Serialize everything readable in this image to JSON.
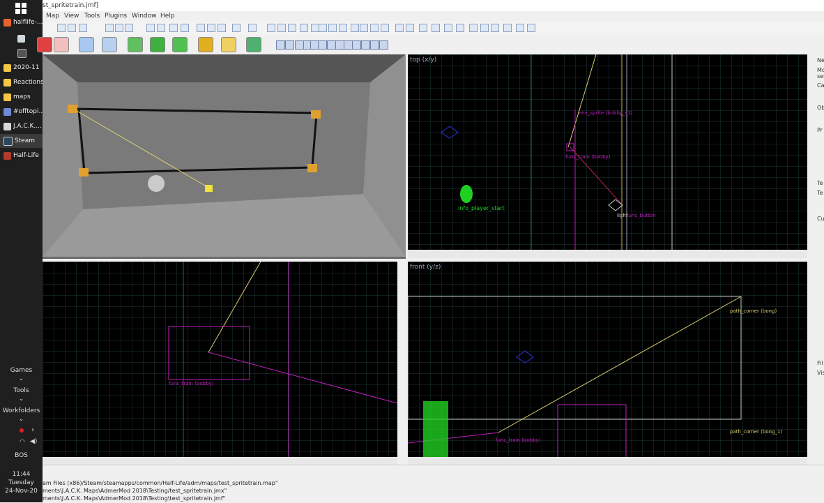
{
  "taskbar": {
    "items": [
      {
        "label": "halflife-...",
        "color": "#e9622e"
      },
      {
        "label": "",
        "color": "#cfd8dc"
      },
      {
        "label": "",
        "color": "#8a8a8a"
      },
      {
        "label": "2020-11",
        "color": "#f6c744"
      },
      {
        "label": "Reactions",
        "color": "#f6c744"
      },
      {
        "label": "maps",
        "color": "#f6c744"
      },
      {
        "label": "#offtopi...",
        "color": "#7289da"
      },
      {
        "label": "J.A.C.K....",
        "color": "#d8d8d8"
      },
      {
        "label": "Steam",
        "color": "#2a475e"
      },
      {
        "label": "Half-Life",
        "color": "#b23a2a"
      }
    ],
    "groups": [
      "Games",
      "Tools",
      "Workfolders"
    ],
    "location": "BOS",
    "time": "11:44",
    "day": "Tuesday",
    "date": "24-Nov-20"
  },
  "window": {
    "title": "st_spritetrain.jmf]"
  },
  "menu": [
    "Map",
    "View",
    "Tools",
    "Plugins",
    "Window",
    "Help"
  ],
  "viewports": {
    "top_label": "top (x/y)",
    "front_label": "front (y/z)",
    "side_label": ""
  },
  "entities": {
    "info_player_start": "info_player_start",
    "func_train_top": "func_train (bobby)",
    "env_sprite": "env_sprite (bobby_s1)",
    "func_button": "func_button",
    "light": "light",
    "func_train_side": "func_train (bobby)",
    "path_corner_top": "path_corner (bong)",
    "path_corner_bottom": "path_corner (bong_1)",
    "func_train_front": "func_train (bobby)"
  },
  "right_panel": [
    "Ne",
    "Mo",
    "sel",
    "Ca",
    "Ob",
    "Pr",
    "Te",
    "Te",
    "Cu",
    "Fil",
    "Vis"
  ],
  "status_lines": [
    "am Files (x86)/Steam/steamapps/common/Half-Life/adm/maps/test_spritetrain.map\"",
    "ments\\J.A.C.K. Maps\\AdmerMod 2018\\Testing/test_spritetrain.jmx\"",
    "ments\\J.A.C.K. Maps\\AdmerMod 2018\\Testing\\test_spritetrain.jmf\""
  ],
  "colors": {
    "entity": "#c020c0",
    "path": "#d8d0a0",
    "player": "#20d020",
    "grid": "#1a3a3a"
  }
}
